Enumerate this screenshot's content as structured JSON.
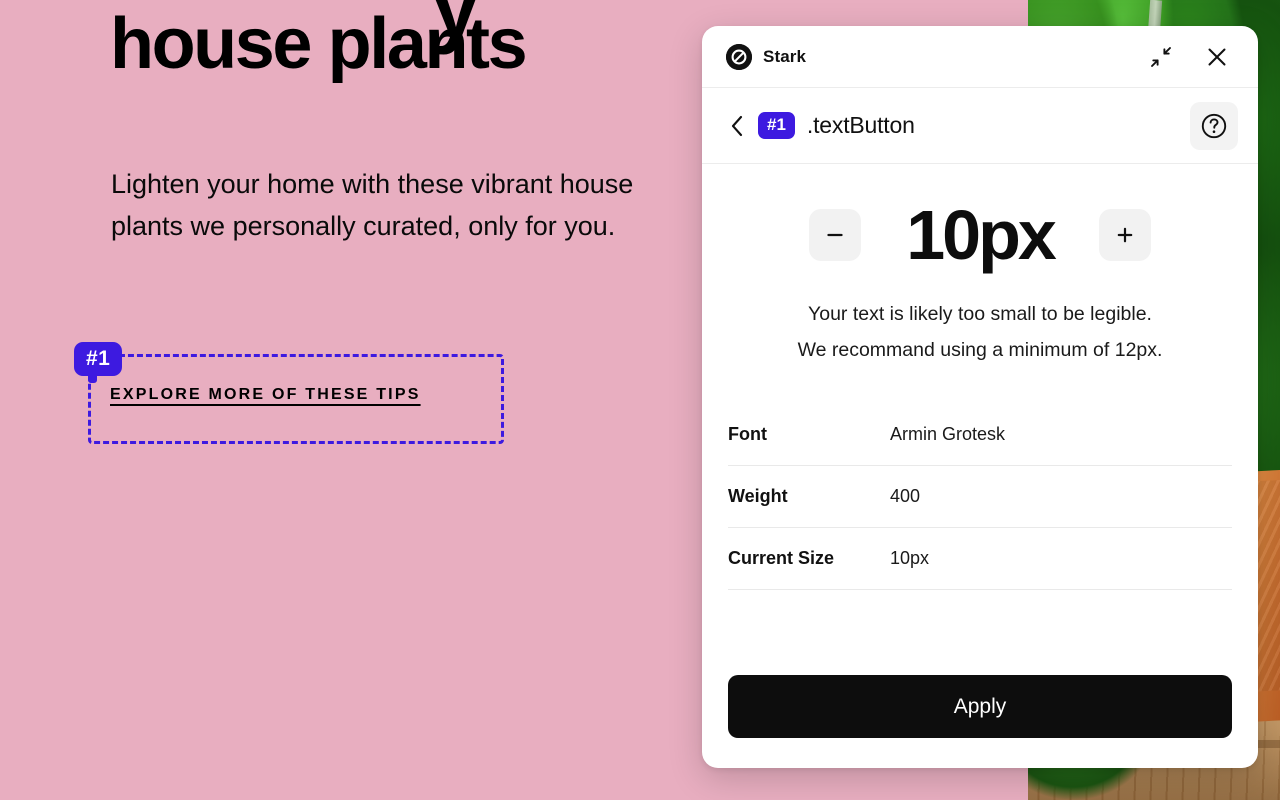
{
  "theme": {
    "page_background": "#e8aec0",
    "accent_purple": "#3d1ae0",
    "panel_background": "#ffffff",
    "apply_button_background": "#0d0d0d",
    "step_button_background": "#f2f2f2"
  },
  "page": {
    "ascender_fragment": "y",
    "heading": "house plants",
    "subheading": "Lighten your home with these vibrant house plants we personally curated, only for you.",
    "annotation": {
      "badge": "#1",
      "link_label": "EXPLORE MORE OF THESE TIPS"
    }
  },
  "panel": {
    "titlebar": {
      "brand_name": "Stark",
      "logo_icon": "stark-logo-icon",
      "minimize_icon": "collapse-arrows-icon",
      "close_icon": "close-icon"
    },
    "subheader": {
      "back_icon": "chevron-left-icon",
      "selection_badge": "#1",
      "selection_name": ".textButton",
      "help_icon": "question-mark-circle-icon"
    },
    "size_control": {
      "decrement_label": "–",
      "decrement_icon": "minus-icon",
      "increment_label": "+",
      "increment_icon": "plus-icon",
      "value": "10px"
    },
    "advisory": {
      "line1": "Your text is likely too small to be legible.",
      "line2": "We recommand using a minimum of 12px."
    },
    "properties": [
      {
        "label": "Font",
        "value": "Armin Grotesk"
      },
      {
        "label": "Weight",
        "value": "400"
      },
      {
        "label": "Current Size",
        "value": "10px"
      }
    ],
    "footer": {
      "apply_label": "Apply"
    }
  }
}
